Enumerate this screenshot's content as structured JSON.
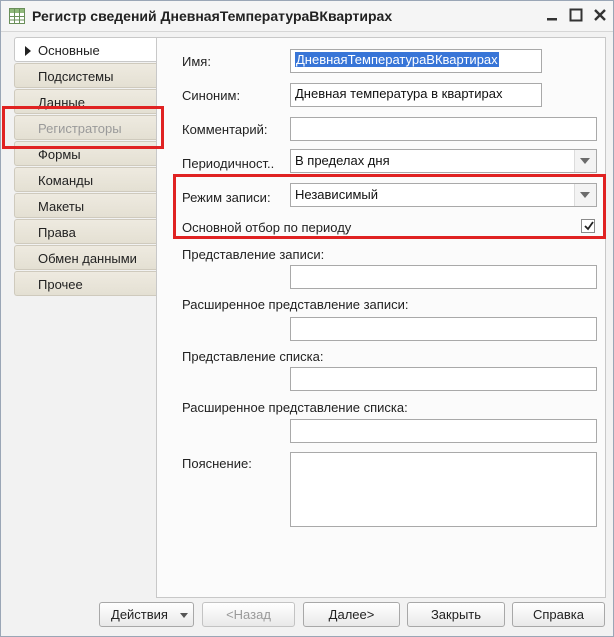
{
  "window": {
    "title": "Регистр сведений ДневнаяТемператураВКвартирах"
  },
  "tabs": [
    {
      "label": "Основные",
      "state": "active"
    },
    {
      "label": "Подсистемы",
      "state": "normal"
    },
    {
      "label": "Данные",
      "state": "normal"
    },
    {
      "label": "Регистраторы",
      "state": "disabled"
    },
    {
      "label": "Формы",
      "state": "normal"
    },
    {
      "label": "Команды",
      "state": "normal"
    },
    {
      "label": "Макеты",
      "state": "normal"
    },
    {
      "label": "Права",
      "state": "normal"
    },
    {
      "label": "Обмен данными",
      "state": "normal"
    },
    {
      "label": "Прочее",
      "state": "normal"
    }
  ],
  "form": {
    "name_label": "Имя:",
    "name_value": "ДневнаяТемператураВКвартирах",
    "synonym_label": "Синоним:",
    "synonym_value": "Дневная температура в квартирах",
    "comment_label": "Комментарий:",
    "comment_value": "",
    "periodicity_label": "Периодичност..",
    "periodicity_value": "В пределах дня",
    "write_mode_label": "Режим записи:",
    "write_mode_value": "Независимый",
    "main_filter_label": "Основной отбор по периоду",
    "main_filter_checked": true,
    "record_presentation_label": "Представление записи:",
    "record_presentation_value": "",
    "ext_record_presentation_label": "Расширенное представление записи:",
    "ext_record_presentation_value": "",
    "list_presentation_label": "Представление списка:",
    "list_presentation_value": "",
    "ext_list_presentation_label": "Расширенное представление списка:",
    "ext_list_presentation_value": "",
    "explanation_label": "Пояснение:",
    "explanation_value": ""
  },
  "buttons": {
    "actions": "Действия",
    "back": "<Назад",
    "next": "Далее>",
    "close": "Закрыть",
    "help": "Справка"
  },
  "colors": {
    "highlight_box": "#e02222",
    "selection": "#3875d7"
  }
}
